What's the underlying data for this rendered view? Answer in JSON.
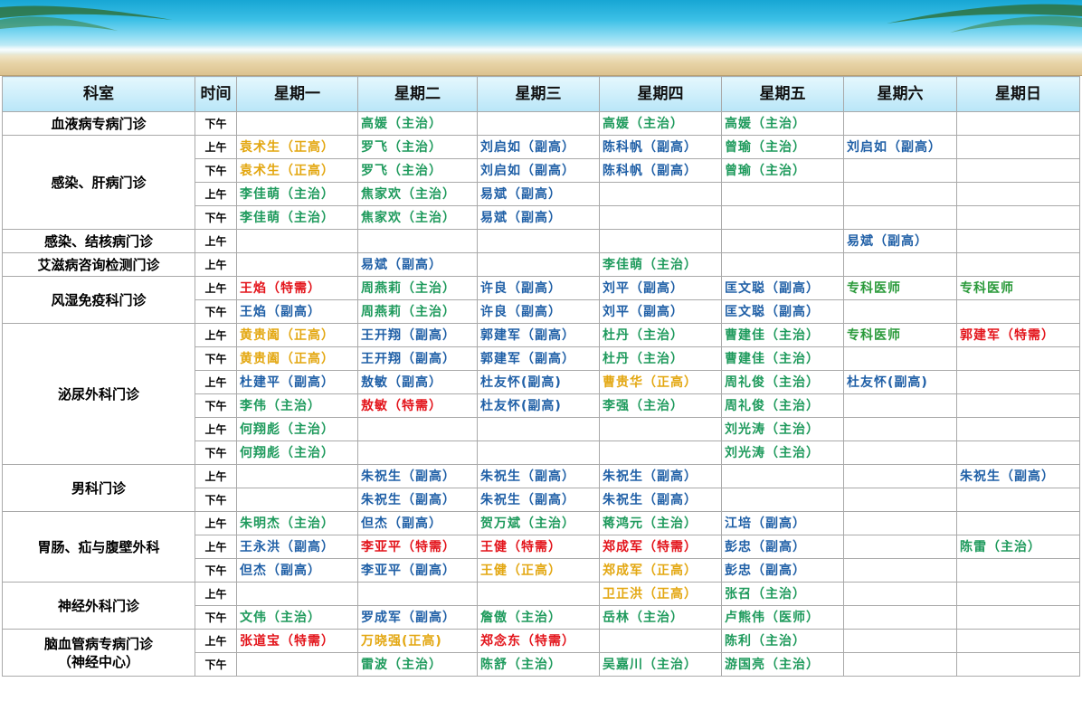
{
  "colors": {
    "teal": "#1e9a5c",
    "blue": "#1f5fa6",
    "gold": "#e3a711",
    "red": "#e3141b",
    "green": "#2a9a3a"
  },
  "headers": [
    "科室",
    "时间",
    "星期一",
    "星期二",
    "星期三",
    "星期四",
    "星期五",
    "星期六",
    "星期日"
  ],
  "departments": [
    {
      "name": "血液病专病门诊",
      "rows": [
        {
          "time": "下午",
          "cells": [
            null,
            {
              "t": "高媛（主治）",
              "c": "teal"
            },
            null,
            {
              "t": "高媛（主治）",
              "c": "teal"
            },
            {
              "t": "高媛（主治）",
              "c": "teal"
            },
            null,
            null
          ]
        }
      ]
    },
    {
      "name": "感染、肝病门诊",
      "rows": [
        {
          "time": "上午",
          "cells": [
            {
              "t": "袁术生（正高）",
              "c": "gold"
            },
            {
              "t": "罗飞（主治）",
              "c": "teal"
            },
            {
              "t": "刘启如（副高）",
              "c": "blue"
            },
            {
              "t": "陈科帆（副高）",
              "c": "blue"
            },
            {
              "t": "曾瑜（主治）",
              "c": "teal"
            },
            {
              "t": "刘启如（副高）",
              "c": "blue"
            },
            null
          ]
        },
        {
          "time": "下午",
          "cells": [
            {
              "t": "袁术生（正高）",
              "c": "gold"
            },
            {
              "t": "罗飞（主治）",
              "c": "teal"
            },
            {
              "t": "刘启如（副高）",
              "c": "blue"
            },
            {
              "t": "陈科帆（副高）",
              "c": "blue"
            },
            {
              "t": "曾瑜（主治）",
              "c": "teal"
            },
            null,
            null
          ]
        },
        {
          "time": "上午",
          "cells": [
            {
              "t": "李佳萌（主治）",
              "c": "teal"
            },
            {
              "t": "焦家欢（主治）",
              "c": "teal"
            },
            {
              "t": "易斌（副高）",
              "c": "blue"
            },
            null,
            null,
            null,
            null
          ]
        },
        {
          "time": "下午",
          "cells": [
            {
              "t": "李佳萌（主治）",
              "c": "teal"
            },
            {
              "t": "焦家欢（主治）",
              "c": "teal"
            },
            {
              "t": "易斌（副高）",
              "c": "blue"
            },
            null,
            null,
            null,
            null
          ]
        }
      ]
    },
    {
      "name": "感染、结核病门诊",
      "rows": [
        {
          "time": "上午",
          "cells": [
            null,
            null,
            null,
            null,
            null,
            {
              "t": "易斌（副高）",
              "c": "blue"
            },
            null
          ]
        }
      ]
    },
    {
      "name": "艾滋病咨询检测门诊",
      "rows": [
        {
          "time": "上午",
          "cells": [
            null,
            {
              "t": "易斌（副高）",
              "c": "blue"
            },
            null,
            {
              "t": "李佳萌（主治）",
              "c": "teal"
            },
            null,
            null,
            null
          ]
        }
      ]
    },
    {
      "name": "风湿免疫科门诊",
      "rows": [
        {
          "time": "上午",
          "cells": [
            {
              "t": "王焰（特需）",
              "c": "red"
            },
            {
              "t": "周燕莉（主治）",
              "c": "teal"
            },
            {
              "t": "许良（副高）",
              "c": "blue"
            },
            {
              "t": "刘平（副高）",
              "c": "blue"
            },
            {
              "t": "匡文聪（副高）",
              "c": "blue"
            },
            {
              "t": "专科医师",
              "c": "green"
            },
            {
              "t": "专科医师",
              "c": "green"
            }
          ]
        },
        {
          "time": "下午",
          "cells": [
            {
              "t": "王焰（副高）",
              "c": "blue"
            },
            {
              "t": "周燕莉（主治）",
              "c": "teal"
            },
            {
              "t": "许良（副高）",
              "c": "blue"
            },
            {
              "t": "刘平（副高）",
              "c": "blue"
            },
            {
              "t": "匡文聪（副高）",
              "c": "blue"
            },
            null,
            null
          ]
        }
      ]
    },
    {
      "name": "泌尿外科门诊",
      "rows": [
        {
          "time": "上午",
          "cells": [
            {
              "t": "黄贵阖（正高）",
              "c": "gold"
            },
            {
              "t": "王开翔（副高）",
              "c": "blue"
            },
            {
              "t": "郭建军（副高）",
              "c": "blue"
            },
            {
              "t": "杜丹（主治）",
              "c": "teal"
            },
            {
              "t": "曹建佳（主治）",
              "c": "teal"
            },
            {
              "t": "专科医师",
              "c": "green"
            },
            {
              "t": "郭建军（特需）",
              "c": "red"
            }
          ]
        },
        {
          "time": "下午",
          "cells": [
            {
              "t": "黄贵阖（正高）",
              "c": "gold"
            },
            {
              "t": "王开翔（副高）",
              "c": "blue"
            },
            {
              "t": "郭建军（副高）",
              "c": "blue"
            },
            {
              "t": "杜丹（主治）",
              "c": "teal"
            },
            {
              "t": "曹建佳（主治）",
              "c": "teal"
            },
            null,
            null
          ]
        },
        {
          "time": "上午",
          "cells": [
            {
              "t": "杜建平（副高）",
              "c": "blue"
            },
            {
              "t": "敖敏（副高）",
              "c": "blue"
            },
            {
              "t": "杜友怀(副高)",
              "c": "blue"
            },
            {
              "t": "曹贵华（正高）",
              "c": "gold"
            },
            {
              "t": "周礼俊（主治）",
              "c": "teal"
            },
            {
              "t": "杜友怀(副高)",
              "c": "blue"
            },
            null
          ]
        },
        {
          "time": "下午",
          "cells": [
            {
              "t": "李伟（主治）",
              "c": "teal"
            },
            {
              "t": "敖敏（特需）",
              "c": "red"
            },
            {
              "t": "杜友怀(副高)",
              "c": "blue"
            },
            {
              "t": "李强（主治）",
              "c": "teal"
            },
            {
              "t": "周礼俊（主治）",
              "c": "teal"
            },
            null,
            null
          ]
        },
        {
          "time": "上午",
          "cells": [
            {
              "t": "何翔彪（主治）",
              "c": "teal"
            },
            null,
            null,
            null,
            {
              "t": "刘光涛（主治）",
              "c": "teal"
            },
            null,
            null
          ]
        },
        {
          "time": "下午",
          "cells": [
            {
              "t": "何翔彪（主治）",
              "c": "teal"
            },
            null,
            null,
            null,
            {
              "t": "刘光涛（主治）",
              "c": "teal"
            },
            null,
            null
          ]
        }
      ]
    },
    {
      "name": "男科门诊",
      "rows": [
        {
          "time": "上午",
          "cells": [
            null,
            {
              "t": "朱祝生（副高）",
              "c": "blue"
            },
            {
              "t": "朱祝生（副高）",
              "c": "blue"
            },
            {
              "t": "朱祝生（副高）",
              "c": "blue"
            },
            null,
            null,
            {
              "t": "朱祝生（副高）",
              "c": "blue"
            }
          ]
        },
        {
          "time": "下午",
          "cells": [
            null,
            {
              "t": "朱祝生（副高）",
              "c": "blue"
            },
            {
              "t": "朱祝生（副高）",
              "c": "blue"
            },
            {
              "t": "朱祝生（副高）",
              "c": "blue"
            },
            null,
            null,
            null
          ]
        }
      ]
    },
    {
      "name": "胃肠、疝与腹壁外科",
      "rows": [
        {
          "time": "上午",
          "cells": [
            {
              "t": "朱明杰（主治）",
              "c": "teal"
            },
            {
              "t": "但杰（副高）",
              "c": "blue"
            },
            {
              "t": "贺万斌（主治）",
              "c": "teal"
            },
            {
              "t": "蒋鸿元（主治）",
              "c": "teal"
            },
            {
              "t": "江培（副高）",
              "c": "blue"
            },
            null,
            null
          ]
        },
        {
          "time": "上午",
          "cells": [
            {
              "t": "王永洪（副高）",
              "c": "blue"
            },
            {
              "t": "李亚平（特需）",
              "c": "red"
            },
            {
              "t": "王健（特需）",
              "c": "red"
            },
            {
              "t": "郑成军（特需）",
              "c": "red"
            },
            {
              "t": "彭忠（副高）",
              "c": "blue"
            },
            null,
            {
              "t": "陈雷（主治）",
              "c": "teal"
            }
          ]
        },
        {
          "time": "下午",
          "cells": [
            {
              "t": "但杰（副高）",
              "c": "blue"
            },
            {
              "t": "李亚平（副高）",
              "c": "blue"
            },
            {
              "t": "王健（正高）",
              "c": "gold"
            },
            {
              "t": "郑成军（正高）",
              "c": "gold"
            },
            {
              "t": "彭忠（副高）",
              "c": "blue"
            },
            null,
            null
          ]
        }
      ]
    },
    {
      "name": "神经外科门诊",
      "rows": [
        {
          "time": "上午",
          "cells": [
            null,
            null,
            null,
            {
              "t": "卫正洪（正高）",
              "c": "gold"
            },
            {
              "t": "张召（主治）",
              "c": "teal"
            },
            null,
            null
          ]
        },
        {
          "time": "下午",
          "cells": [
            {
              "t": "文伟（主治）",
              "c": "teal"
            },
            {
              "t": "罗成军（副高）",
              "c": "blue"
            },
            {
              "t": "詹傲（主治）",
              "c": "teal"
            },
            {
              "t": "岳林（主治）",
              "c": "teal"
            },
            {
              "t": "卢熊伟（医师）",
              "c": "teal"
            },
            null,
            null
          ]
        }
      ]
    },
    {
      "name": "脑血管病专病门诊",
      "name2": "（神经中心）",
      "rows": [
        {
          "time": "上午",
          "cells": [
            {
              "t": "张道宝（特需）",
              "c": "red"
            },
            {
              "t": "万晓强(正高)",
              "c": "gold"
            },
            {
              "t": "郑念东（特需）",
              "c": "red"
            },
            null,
            {
              "t": "陈利（主治）",
              "c": "teal"
            },
            null,
            null
          ]
        },
        {
          "time": "下午",
          "cells": [
            null,
            {
              "t": "雷波（主治）",
              "c": "teal"
            },
            {
              "t": "陈舒（主治）",
              "c": "teal"
            },
            {
              "t": "吴嘉川（主治）",
              "c": "teal"
            },
            {
              "t": "游国亮（主治）",
              "c": "teal"
            },
            null,
            null
          ]
        }
      ]
    }
  ]
}
